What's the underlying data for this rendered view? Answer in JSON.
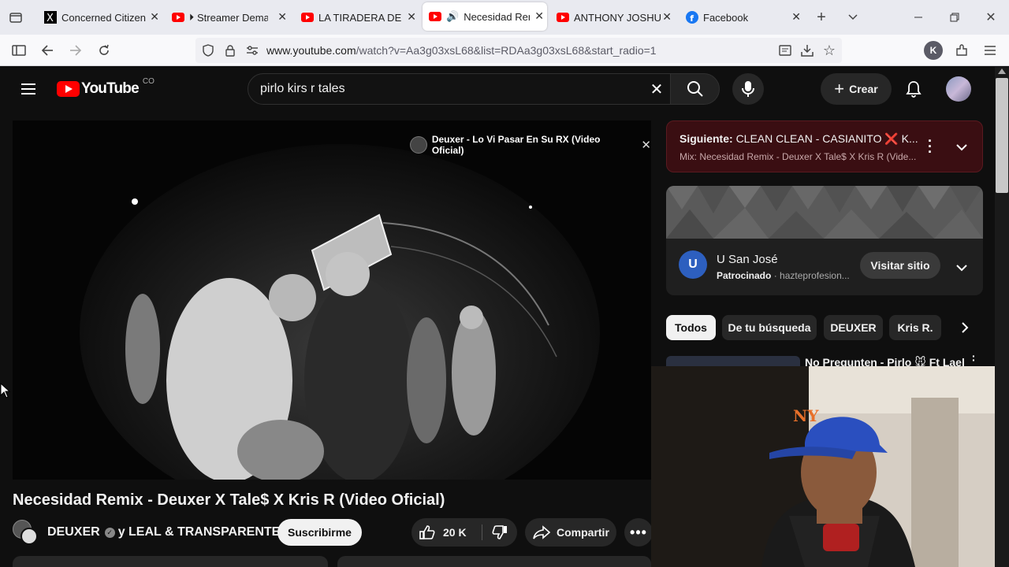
{
  "browser": {
    "tabs": [
      {
        "title": "Concerned Citizen o",
        "icon": "x-logo-icon"
      },
      {
        "title": "Streamer Dema",
        "icon": "youtube-icon"
      },
      {
        "title": "LA TIRADERA DE PIF",
        "icon": "youtube-icon"
      },
      {
        "title": "Necesidad Rem",
        "icon": "youtube-icon",
        "active": true
      },
      {
        "title": "ANTHONY JOSHUA",
        "icon": "youtube-icon"
      },
      {
        "title": "Facebook",
        "icon": "facebook-icon"
      }
    ],
    "url_host": "www.youtube.com",
    "url_path": "/watch?v=Aa3g03xsL68&list=RDAa3g03xsL68&start_radio=1",
    "profile_letter": "K"
  },
  "youtube": {
    "logo_text": "YouTube",
    "country": "CO",
    "search_value": "pirlo kirs r tales",
    "create_label": "Crear",
    "video": {
      "overlay_text": "Deuxer - Lo Vi Pasar En Su RX (Video Oficial)",
      "title": "Necesidad Remix - Deuxer X Tale$ X Kris R (Video Oficial)"
    },
    "channel": {
      "name": "DEUXER",
      "collab": "y LEAL & TRANSPARENTE",
      "subscribe_label": "Suscribirme"
    },
    "actions": {
      "likes": "20 K",
      "share_label": "Compartir"
    },
    "next_up": {
      "label": "Siguiente:",
      "title": "CLEAN CLEAN - CASIANITO ❌ K...",
      "subtitle": "Mix: Necesidad Remix - Deuxer X Tale$ X Kris R (Vide..."
    },
    "ad": {
      "name": "U San José",
      "sponsored": "Patrocinado",
      "domain": "hazteprofesion...",
      "cta": "Visitar sitio"
    },
    "chips": [
      "Todos",
      "De tu búsqueda",
      "DEUXER",
      "Kris R."
    ],
    "rec_partial_title": "No Pregunten - Pirlo 🐭 Ft Lael"
  },
  "colors": {
    "yt_red": "#ff0000",
    "bg": "#0f0f0f",
    "next_card": "#3a0e12"
  }
}
